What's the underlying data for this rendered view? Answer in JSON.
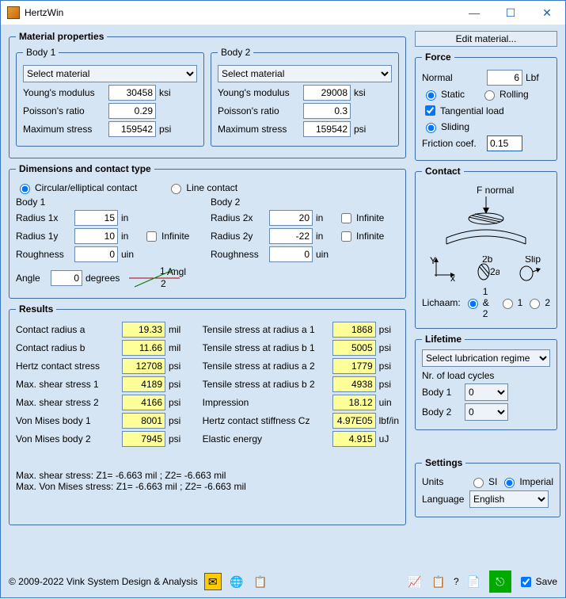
{
  "window": {
    "title": "HertzWin"
  },
  "panels": {
    "material_properties": "Material properties",
    "dimensions": "Dimensions and contact type",
    "results": "Results",
    "force": "Force",
    "contact": "Contact",
    "lifetime": "Lifetime",
    "settings": "Settings",
    "body1": "Body 1",
    "body2": "Body 2"
  },
  "material": {
    "select_placeholder": "Select material",
    "young_label": "Young's modulus",
    "poisson_label": "Poisson's ratio",
    "maxstress_label": "Maximum stress",
    "ksi": "ksi",
    "psi": "psi",
    "body1": {
      "young": "30458",
      "poisson": "0.29",
      "maxstress": "159542"
    },
    "body2": {
      "young": "29008",
      "poisson": "0.3",
      "maxstress": "159542"
    }
  },
  "dimensions": {
    "circular": "Circular/elliptical contact",
    "line": "Line contact",
    "radius1x": "Radius 1x",
    "radius1y": "Radius 1y",
    "radius2x": "Radius 2x",
    "radius2y": "Radius 2y",
    "roughness": "Roughness",
    "infinite": "Infinite",
    "angle_label": "Angle",
    "degrees": "degrees",
    "in": "in",
    "uin": "uin",
    "body1": {
      "r1x": "15",
      "r1y": "10",
      "rough": "0"
    },
    "body2": {
      "r2x": "20",
      "r2y": "-22",
      "rough": "0"
    },
    "angle": "0"
  },
  "results": {
    "contact_radius_a": "Contact radius a",
    "val_a": "19.33",
    "u_a": "mil",
    "contact_radius_b": "Contact radius b",
    "val_b": "11.66",
    "u_b": "mil",
    "hertz_stress": "Hertz contact stress",
    "val_hs": "12708",
    "u_hs": "psi",
    "max_shear1": "Max. shear stress 1",
    "val_ms1": "4189",
    "u_ms1": "psi",
    "max_shear2": "Max. shear stress 2",
    "val_ms2": "4166",
    "u_ms2": "psi",
    "vm1": "Von Mises body 1",
    "val_vm1": "8001",
    "u_vm1": "psi",
    "vm2": "Von Mises body 2",
    "val_vm2": "7945",
    "u_vm2": "psi",
    "ts_a1": "Tensile stress at radius a 1",
    "val_ts_a1": "1868",
    "u_ts_a1": "psi",
    "ts_b1": "Tensile stress at radius b 1",
    "val_ts_b1": "5005",
    "u_ts_b1": "psi",
    "ts_a2": "Tensile stress at radius a 2",
    "val_ts_a2": "1779",
    "u_ts_a2": "psi",
    "ts_b2": "Tensile stress at radius b 2",
    "val_ts_b2": "4938",
    "u_ts_b2": "psi",
    "impression": "Impression",
    "val_imp": "18.12",
    "u_imp": "uin",
    "stiffness": "Hertz contact stiffness Cz",
    "val_cz": "4.97E05",
    "u_cz": "lbf/in",
    "energy": "Elastic energy",
    "val_e": "4.915",
    "u_e": "uJ",
    "note1": "Max. shear stress: Z1= -6.663 mil ;  Z2= -6.663 mil",
    "note2": "Max. Von Mises stress: Z1= -6.663 mil ;  Z2= -6.663 mil"
  },
  "edit_material_btn": "Edit material...",
  "force": {
    "normal": "Normal",
    "normal_val": "6",
    "lbf": "Lbf",
    "static": "Static",
    "rolling": "Rolling",
    "tangential": "Tangential load",
    "sliding": "Sliding",
    "friction": "Friction coef.",
    "friction_val": "0.15"
  },
  "contact": {
    "f_normal": "F  normal",
    "lichaam": "Lichaam:",
    "o12": "1 & 2",
    "o1": "1",
    "o2": "2",
    "slip": "Slip",
    "a": "2a",
    "b": "2b",
    "x": "x",
    "y": "Y"
  },
  "lifetime": {
    "lub": "Select lubrication regime",
    "cycles": "Nr. of load cycles",
    "b1": "Body 1",
    "b2": "Body 2",
    "zero": "0"
  },
  "settings": {
    "units": "Units",
    "si": "SI",
    "imperial": "Imperial",
    "language": "Language",
    "english": "English"
  },
  "footer": {
    "copyright": "© 2009-2022 Vink System Design & Analysis",
    "save": "Save",
    "q": "?"
  }
}
